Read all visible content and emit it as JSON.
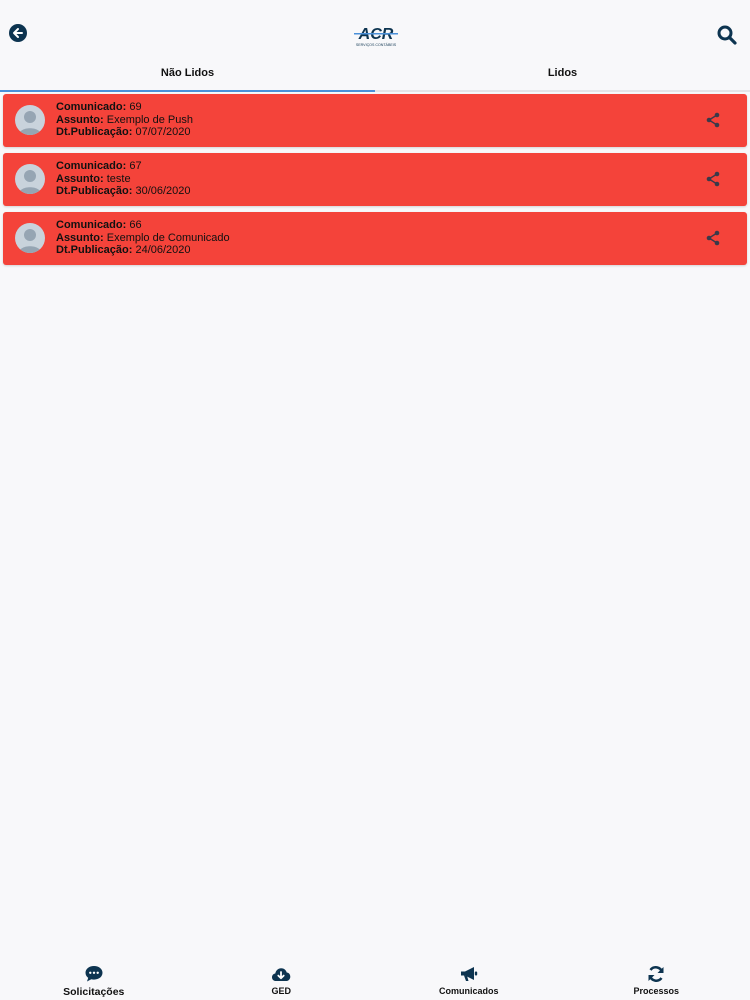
{
  "header": {
    "back_icon": "arrow-left-circle-icon",
    "logo": {
      "text": "ACR",
      "subtext": "SERVIÇOS CONTÁBEIS"
    },
    "search_icon": "search-icon"
  },
  "tabs": [
    {
      "label": "Não Lidos",
      "active": true
    },
    {
      "label": "Lidos",
      "active": false
    }
  ],
  "labels": {
    "comunicado": "Comunicado:",
    "assunto": "Assunto:",
    "publicacao": "Dt.Publicação:"
  },
  "messages": [
    {
      "comunicado": "69",
      "assunto": "Exemplo de Push",
      "publicacao": "07/07/2020"
    },
    {
      "comunicado": "67",
      "assunto": "teste",
      "publicacao": "30/06/2020"
    },
    {
      "comunicado": "66",
      "assunto": "Exemplo de Comunicado",
      "publicacao": "24/06/2020"
    }
  ],
  "colors": {
    "card": "#f4433a",
    "accent": "#4a90d9",
    "brand": "#0d3450"
  },
  "bottom_nav": [
    {
      "label": "Solicitações",
      "icon": "chat-bubble-icon"
    },
    {
      "label": "GED",
      "icon": "cloud-download-icon"
    },
    {
      "label": "Comunicados",
      "icon": "megaphone-icon"
    },
    {
      "label": "Processos",
      "icon": "refresh-icon"
    }
  ]
}
